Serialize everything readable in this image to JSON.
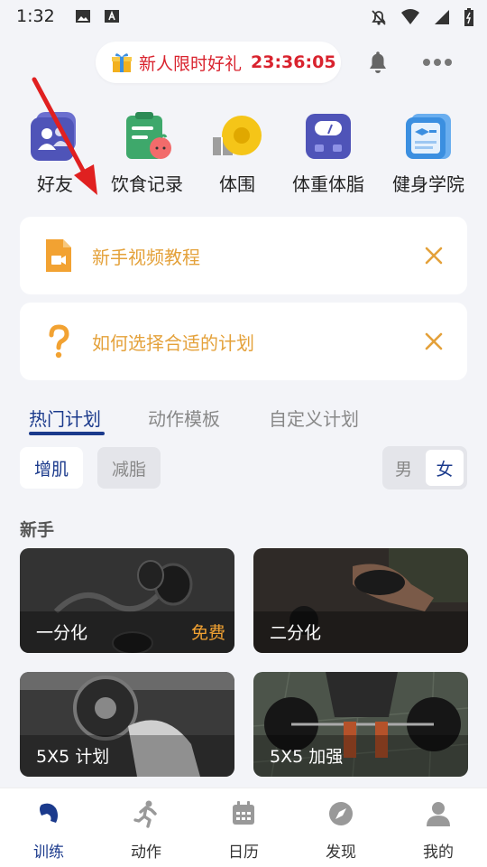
{
  "status_bar": {
    "time": "1:32"
  },
  "promo": {
    "text": "新人限时好礼",
    "timer": "23:36:05"
  },
  "header_icons": {
    "bell": "bell-icon",
    "more": "more-icon"
  },
  "shortcuts": [
    {
      "label": "好友",
      "icon": "friends-icon"
    },
    {
      "label": "饮食记录",
      "icon": "diet-record-icon"
    },
    {
      "label": "体围",
      "icon": "tape-measure-icon"
    },
    {
      "label": "体重体脂",
      "icon": "scale-icon"
    },
    {
      "label": "健身学院",
      "icon": "academy-icon"
    }
  ],
  "cards": [
    {
      "text": "新手视频教程",
      "icon": "video-file-icon"
    },
    {
      "text": "如何选择合适的计划",
      "icon": "question-icon"
    }
  ],
  "tabs": [
    "热门计划",
    "动作模板",
    "自定义计划"
  ],
  "active_tab": "热门计划",
  "filters": {
    "gain": "增肌",
    "lose": "减脂"
  },
  "gender": {
    "male": "男",
    "female": "女",
    "selected": "女"
  },
  "section": {
    "title": "新手"
  },
  "plans": [
    {
      "label": "一分化",
      "badge": "免费"
    },
    {
      "label": "二分化",
      "badge": ""
    },
    {
      "label": "5X5 计划",
      "badge": ""
    },
    {
      "label": "5X5 加强",
      "badge": ""
    }
  ],
  "nav": [
    {
      "label": "训练",
      "icon": "training-icon"
    },
    {
      "label": "动作",
      "icon": "runner-icon"
    },
    {
      "label": "日历",
      "icon": "calendar-icon"
    },
    {
      "label": "发现",
      "icon": "compass-icon"
    },
    {
      "label": "我的",
      "icon": "profile-icon"
    }
  ],
  "colors": {
    "accent": "#1b3a8c",
    "promo": "#d9232e",
    "card_text": "#e4a13a",
    "free": "#f2a232"
  }
}
